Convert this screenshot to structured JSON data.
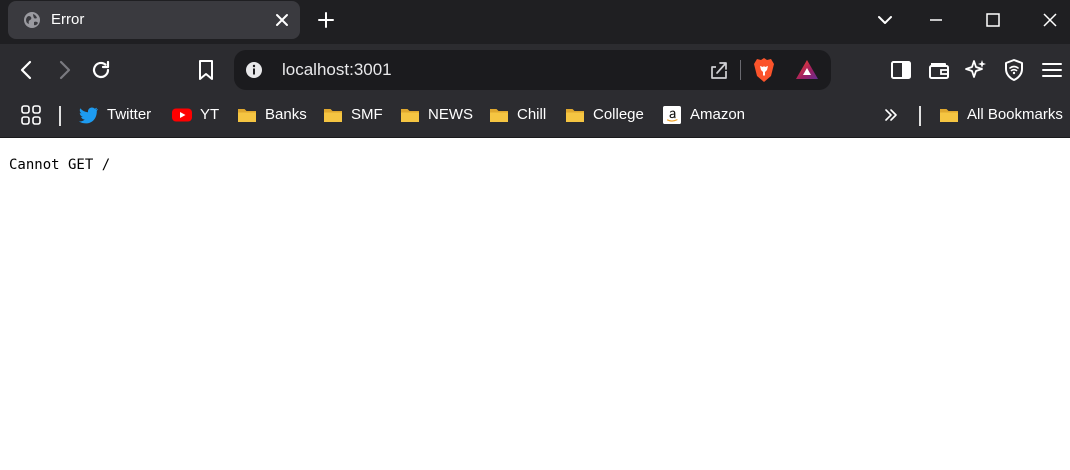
{
  "tab": {
    "title": "Error",
    "favicon": "globe-icon"
  },
  "toolbar": {
    "url": "localhost:3001",
    "icons": [
      "back-icon",
      "forward-icon",
      "reload-icon",
      "bookmark-icon",
      "site-info-icon",
      "share-icon",
      "brave-shields-icon",
      "brave-rewards-icon",
      "sidebar-icon",
      "wallet-icon",
      "leo-ai-icon",
      "vpn-icon",
      "menu-icon"
    ]
  },
  "bookmarks": {
    "items": [
      {
        "label": "Twitter",
        "icon": "twitter-icon"
      },
      {
        "label": "YT",
        "icon": "youtube-icon"
      },
      {
        "label": "Banks",
        "icon": "folder-icon"
      },
      {
        "label": "SMF",
        "icon": "folder-icon"
      },
      {
        "label": "NEWS",
        "icon": "folder-icon"
      },
      {
        "label": "Chill",
        "icon": "folder-icon"
      },
      {
        "label": "College",
        "icon": "folder-icon"
      },
      {
        "label": "Amazon",
        "icon": "amazon-icon"
      }
    ],
    "all_bookmarks": "All Bookmarks"
  },
  "page": {
    "message": "Cannot GET /"
  },
  "colors": {
    "tabstrip_bg": "#1f1f22",
    "toolbar_bg": "#2c2c30",
    "omnibox_bg": "#1b1b1e",
    "folder": "#f5c542",
    "twitter": "#1d9bf0",
    "youtube": "#ff0000",
    "brave_orange": "#fb542b"
  }
}
